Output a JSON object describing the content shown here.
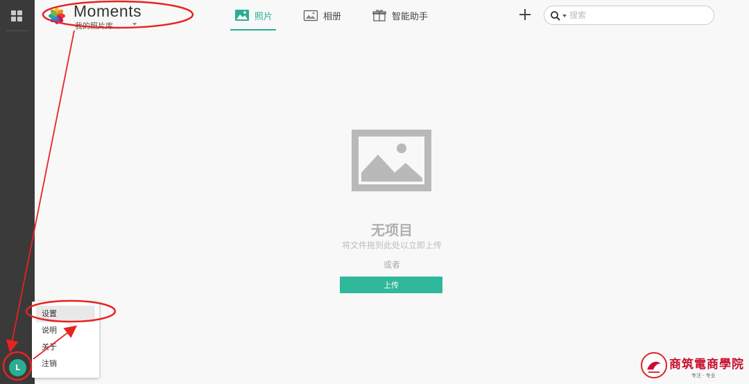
{
  "app": {
    "name": "Moments",
    "library": "我的照片库"
  },
  "tabs": [
    {
      "label": "照片",
      "icon": "photo-icon",
      "active": true
    },
    {
      "label": "相册",
      "icon": "album-icon",
      "active": false
    },
    {
      "label": "智能助手",
      "icon": "gift-icon",
      "active": false
    }
  ],
  "search": {
    "placeholder": "搜索"
  },
  "empty_state": {
    "title": "无项目",
    "subtitle": "将文件拖到此处以立即上传",
    "or": "或者",
    "upload_label": "上传"
  },
  "user": {
    "initial": "L"
  },
  "user_menu": {
    "items": [
      "设置",
      "说明",
      "关于",
      "注销"
    ],
    "active_index": 0
  },
  "watermark": {
    "title": "商筑電商學院",
    "tagline": "专注 · 专业"
  },
  "colors": {
    "accent": "#2aae8f",
    "rail": "#3a3a3a",
    "annotation": "#e8231f"
  }
}
